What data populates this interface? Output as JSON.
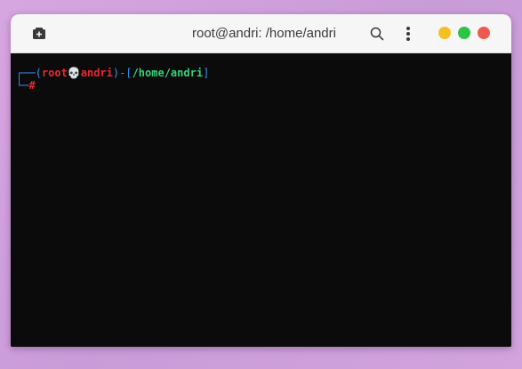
{
  "window": {
    "title": "root@andri: /home/andri"
  },
  "icons": {
    "new_tab": "new-tab-icon",
    "search": "search-icon",
    "menu": "kebab-menu-icon",
    "minimize": "minimize-dot",
    "maximize": "maximize-dot",
    "close": "close-dot"
  },
  "colors": {
    "minimize": "#f4c024",
    "maximize": "#2ec346",
    "close": "#ee5a4f",
    "terminal_bg": "#0b0b0b",
    "prompt_frame": "#3b8df0",
    "prompt_user": "#e8282e",
    "prompt_path": "#36d17a"
  },
  "terminal": {
    "line1": {
      "frame_start": "┌──(",
      "user": "root",
      "skull": "💀",
      "host": "andri",
      "frame_mid": ")-[",
      "path": "/home/andri",
      "frame_end": "]"
    },
    "line2": {
      "frame": "└─",
      "prompt": "#"
    }
  }
}
